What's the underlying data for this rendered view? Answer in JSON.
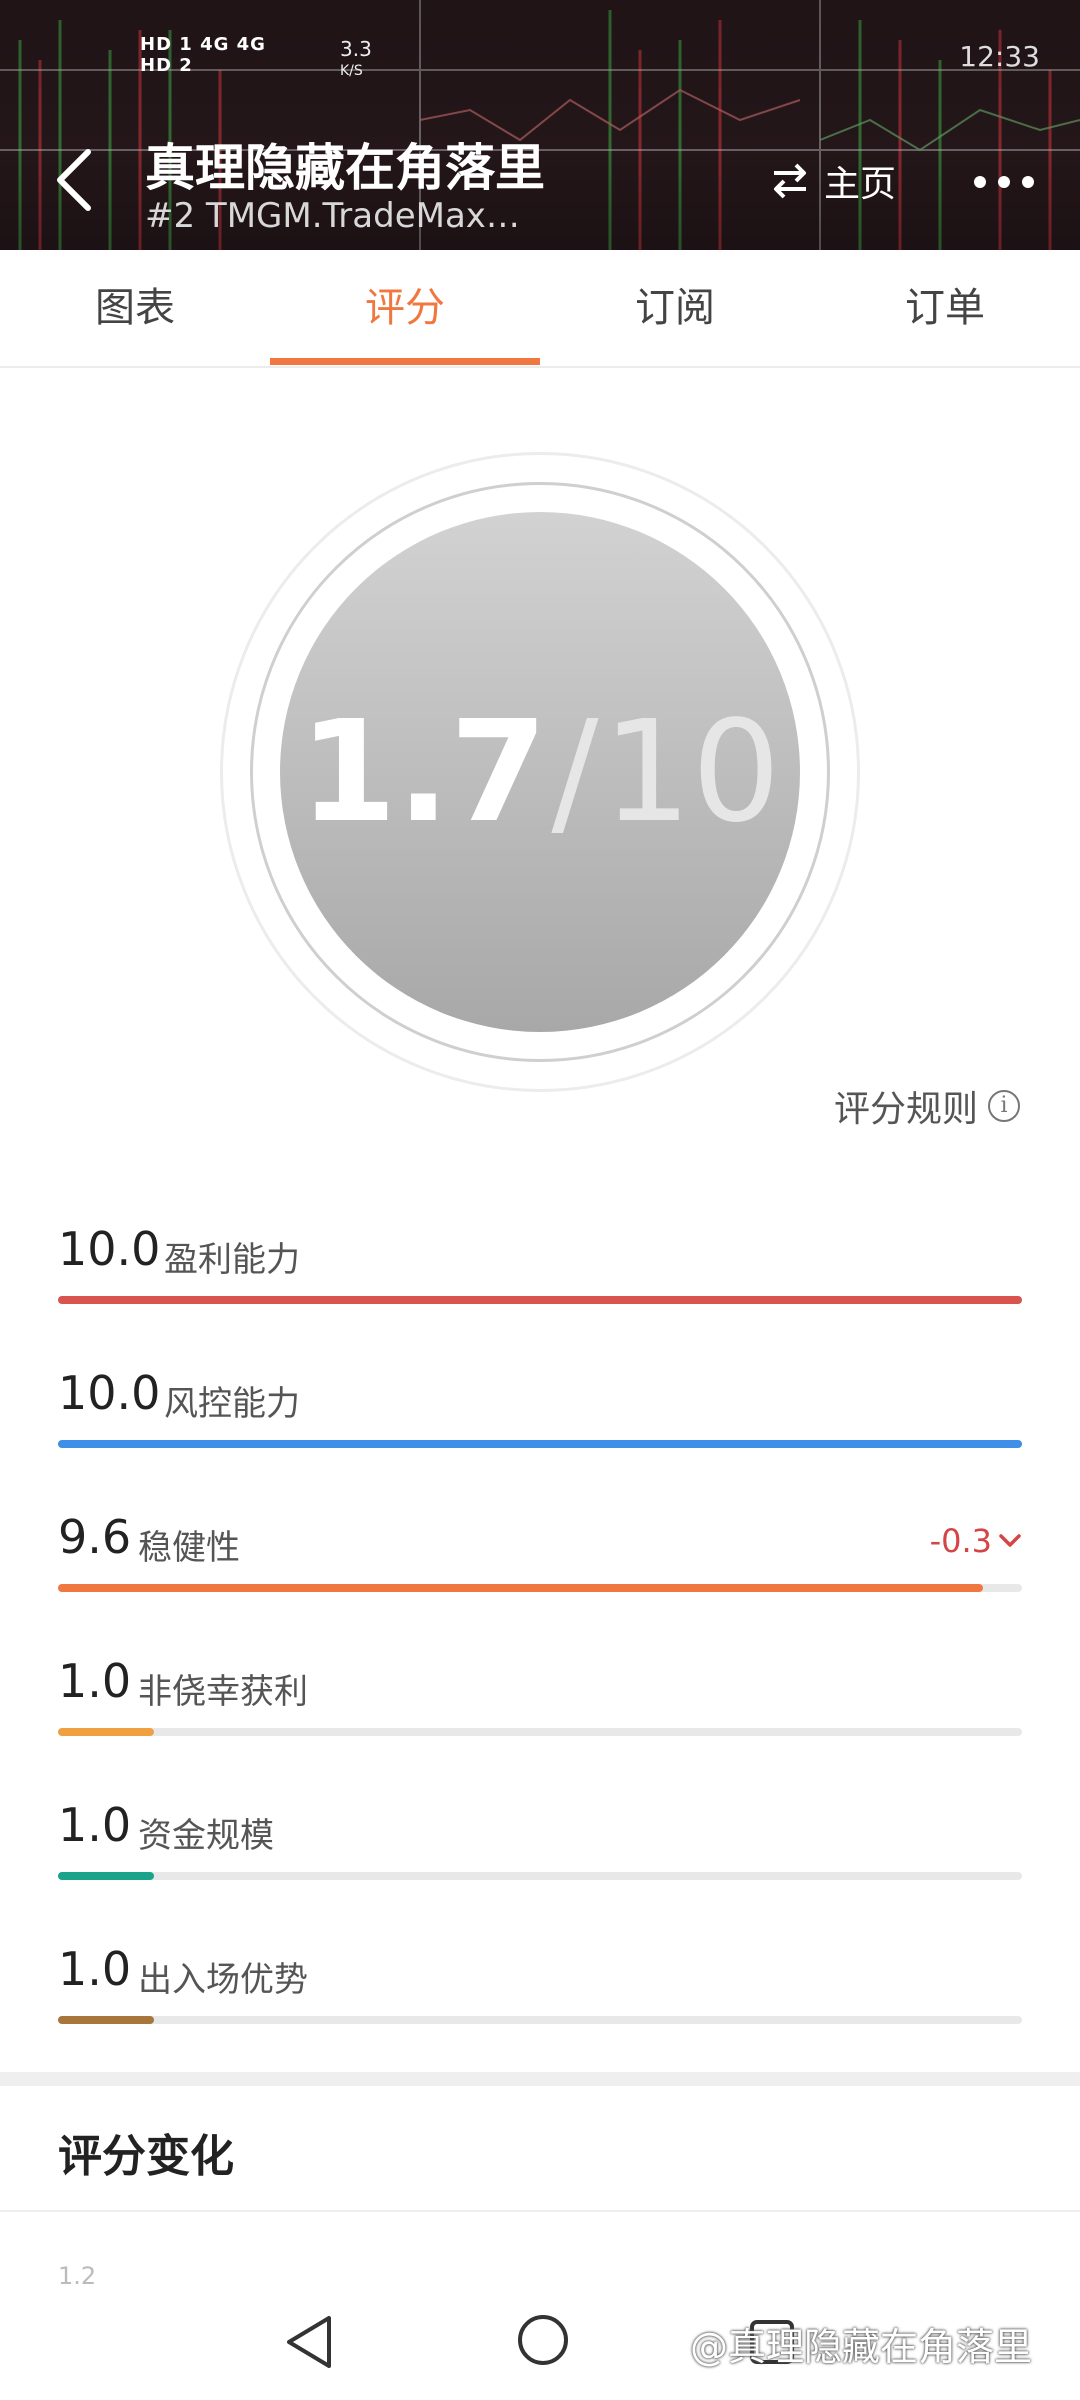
{
  "status_bar": {
    "network_left": "HD 1  4G  4G",
    "network_right": "HD 2",
    "speed_value": "3.3",
    "speed_unit": "K/S",
    "time": "12:33"
  },
  "header": {
    "title": "真理隐藏在角落里",
    "subtitle": "#2  TMGM.TradeMax…",
    "home_label": "主页"
  },
  "tabs": [
    {
      "label": "图表"
    },
    {
      "label": "评分"
    },
    {
      "label": "订阅"
    },
    {
      "label": "订单"
    }
  ],
  "active_tab": 1,
  "score": {
    "value": "1.7",
    "separator": "/",
    "max": "10"
  },
  "rules_label": "评分规则",
  "metrics": [
    {
      "value": "10.0",
      "label": "盈利能力",
      "fraction": 1.0,
      "color": "#d9534f"
    },
    {
      "value": "10.0",
      "label": "风控能力",
      "fraction": 1.0,
      "color": "#3f8ee8"
    },
    {
      "value": "9.6",
      "label": "稳健性",
      "fraction": 0.96,
      "color": "#f07840",
      "change": "-0.3"
    },
    {
      "value": "1.0",
      "label": "非侥幸获利",
      "fraction": 0.1,
      "color": "#f0a040"
    },
    {
      "value": "1.0",
      "label": "资金规模",
      "fraction": 0.1,
      "color": "#19a38a"
    },
    {
      "value": "1.0",
      "label": "出入场优势",
      "fraction": 0.1,
      "color": "#a8753a"
    }
  ],
  "section": {
    "title": "评分变化",
    "axis_start": "1.2"
  },
  "watermark": "@真理隐藏在角落里"
}
